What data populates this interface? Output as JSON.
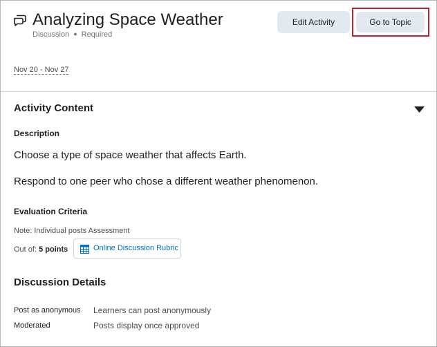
{
  "header": {
    "title": "Analyzing Space Weather",
    "type_label": "Discussion",
    "required_label": "Required",
    "edit_button": "Edit Activity",
    "topic_button": "Go to Topic",
    "dates": "Nov 20 - Nov 27",
    "icon": "discussion-icon"
  },
  "activity": {
    "section_title": "Activity Content",
    "description_label": "Description",
    "paragraphs": [
      "Choose a type of space weather that affects Earth.",
      "Respond to one peer who chose a different weather phenomenon."
    ],
    "evaluation_label": "Evaluation Criteria",
    "assessment_note": "Note: Individual posts Assessment",
    "out_of_label": "Out of:",
    "points": "5 points",
    "rubric_label": "Online Discussion Rubric",
    "rubric_icon": "grid-icon"
  },
  "details": {
    "section_title": "Discussion Details",
    "rows": [
      {
        "key": "Post as anonymous",
        "value": "Learners can post anonymously"
      },
      {
        "key": "Moderated",
        "value": "Posts display once approved"
      }
    ]
  },
  "colors": {
    "accent": "#006fbf",
    "button_bg": "#e3e9f1",
    "focus": "#c8202d"
  }
}
